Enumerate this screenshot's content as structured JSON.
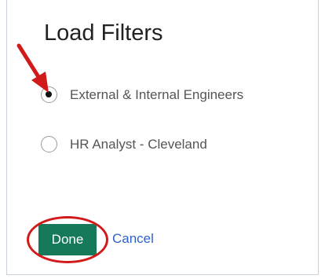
{
  "dialog": {
    "title": "Load Filters",
    "options": [
      {
        "label": "External & Internal Engineers",
        "selected": true
      },
      {
        "label": "HR Analyst - Cleveland",
        "selected": false
      }
    ],
    "done_label": "Done",
    "cancel_label": "Cancel"
  },
  "colors": {
    "done_button": "#167a5a",
    "cancel_link": "#2f62c6",
    "annotation": "#d11a1a"
  },
  "annotations": [
    {
      "type": "arrow",
      "color": "red",
      "points_to": "option-external-internal-engineers"
    },
    {
      "type": "circle",
      "color": "red",
      "highlights": "done-button"
    }
  ]
}
